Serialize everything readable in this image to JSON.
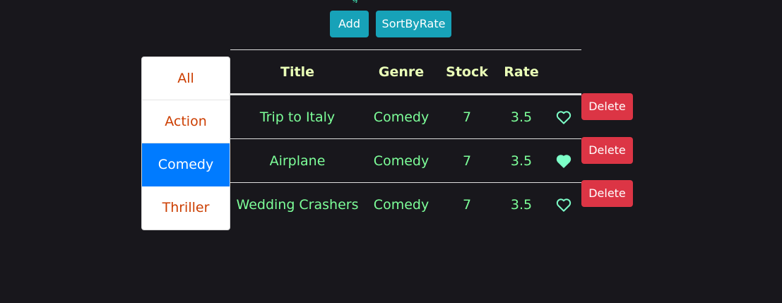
{
  "toolbar": {
    "partial_heading": "g",
    "add_label": "Add",
    "sort_label": "SortByRate"
  },
  "genres": {
    "items": [
      {
        "label": "All",
        "active": false
      },
      {
        "label": "Action",
        "active": false
      },
      {
        "label": "Comedy",
        "active": true
      },
      {
        "label": "Thriller",
        "active": false
      }
    ]
  },
  "table": {
    "headers": {
      "title": "Title",
      "genre": "Genre",
      "stock": "Stock",
      "rate": "Rate"
    },
    "rows": [
      {
        "title": "Trip to Italy",
        "genre": "Comedy",
        "stock": "7",
        "rate": "3.5",
        "liked": false,
        "delete_label": "Delete"
      },
      {
        "title": "Airplane",
        "genre": "Comedy",
        "stock": "7",
        "rate": "3.5",
        "liked": true,
        "delete_label": "Delete"
      },
      {
        "title": "Wedding Crashers",
        "genre": "Comedy",
        "stock": "7",
        "rate": "3.5",
        "liked": false,
        "delete_label": "Delete"
      }
    ]
  },
  "colors": {
    "background": "#18171c",
    "info_button": "#17a2b8",
    "danger_button": "#dc3545",
    "active_genre": "#007bff",
    "genre_text": "#cc3e00",
    "header_text": "#eaffb8",
    "cell_text": "#7dff99",
    "heart": "#7dffc8"
  },
  "icons": {
    "like": "heart-icon"
  }
}
